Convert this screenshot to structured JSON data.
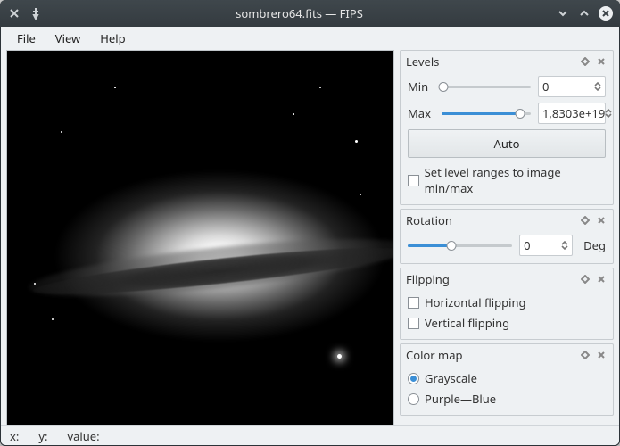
{
  "window": {
    "title": "sombrero64.fits — FIPS"
  },
  "menu": {
    "file": "File",
    "view": "View",
    "help": "Help"
  },
  "panels": {
    "levels": {
      "title": "Levels",
      "min_label": "Min",
      "min_value": "0",
      "min_fill_pct": 0,
      "max_label": "Max",
      "max_value": "1,8303e+19",
      "max_fill_pct": 88,
      "auto": "Auto",
      "range_checkbox": "Set level ranges to image min/max",
      "range_checked": false
    },
    "rotation": {
      "title": "Rotation",
      "value": "0",
      "fill_pct": 42,
      "unit": "Deg"
    },
    "flipping": {
      "title": "Flipping",
      "horizontal": "Horizontal flipping",
      "horizontal_checked": false,
      "vertical": "Vertical flipping",
      "vertical_checked": false
    },
    "colormap": {
      "title": "Color map",
      "grayscale": "Grayscale",
      "grayscale_selected": true,
      "purpleblue": "Purple—Blue",
      "purpleblue_selected": false
    }
  },
  "status": {
    "x": "x:",
    "y": "y:",
    "value": "value:"
  }
}
